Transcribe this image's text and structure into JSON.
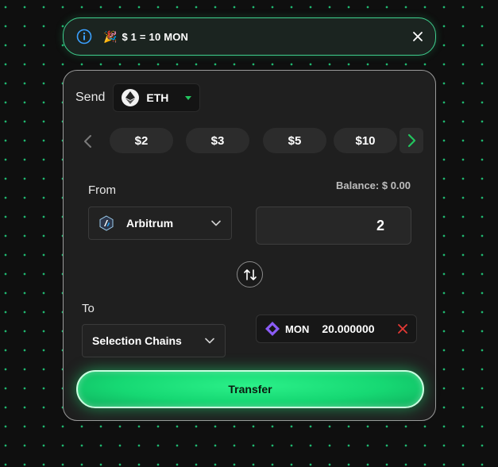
{
  "banner": {
    "rate_text": "$ 1 = 10 MON",
    "party_emoji": "🎉",
    "info_icon": "info-icon",
    "close_icon": "close-icon"
  },
  "send": {
    "label": "Send",
    "token": "ETH"
  },
  "amount_chips": [
    "$2",
    "$3",
    "$5",
    "$10"
  ],
  "from": {
    "label": "From",
    "balance": "Balance: $ 0.00",
    "chain": "Arbitrum",
    "amount": "2"
  },
  "to": {
    "label": "To",
    "chain_placeholder": "Selection Chains",
    "token": "MON",
    "amount": "20.000000"
  },
  "transfer_label": "Transfer",
  "colors": {
    "accent_green": "#22c55e",
    "button_green": "#16d873",
    "close_red": "#e53935",
    "mon_purple": "#8b5cf6"
  }
}
